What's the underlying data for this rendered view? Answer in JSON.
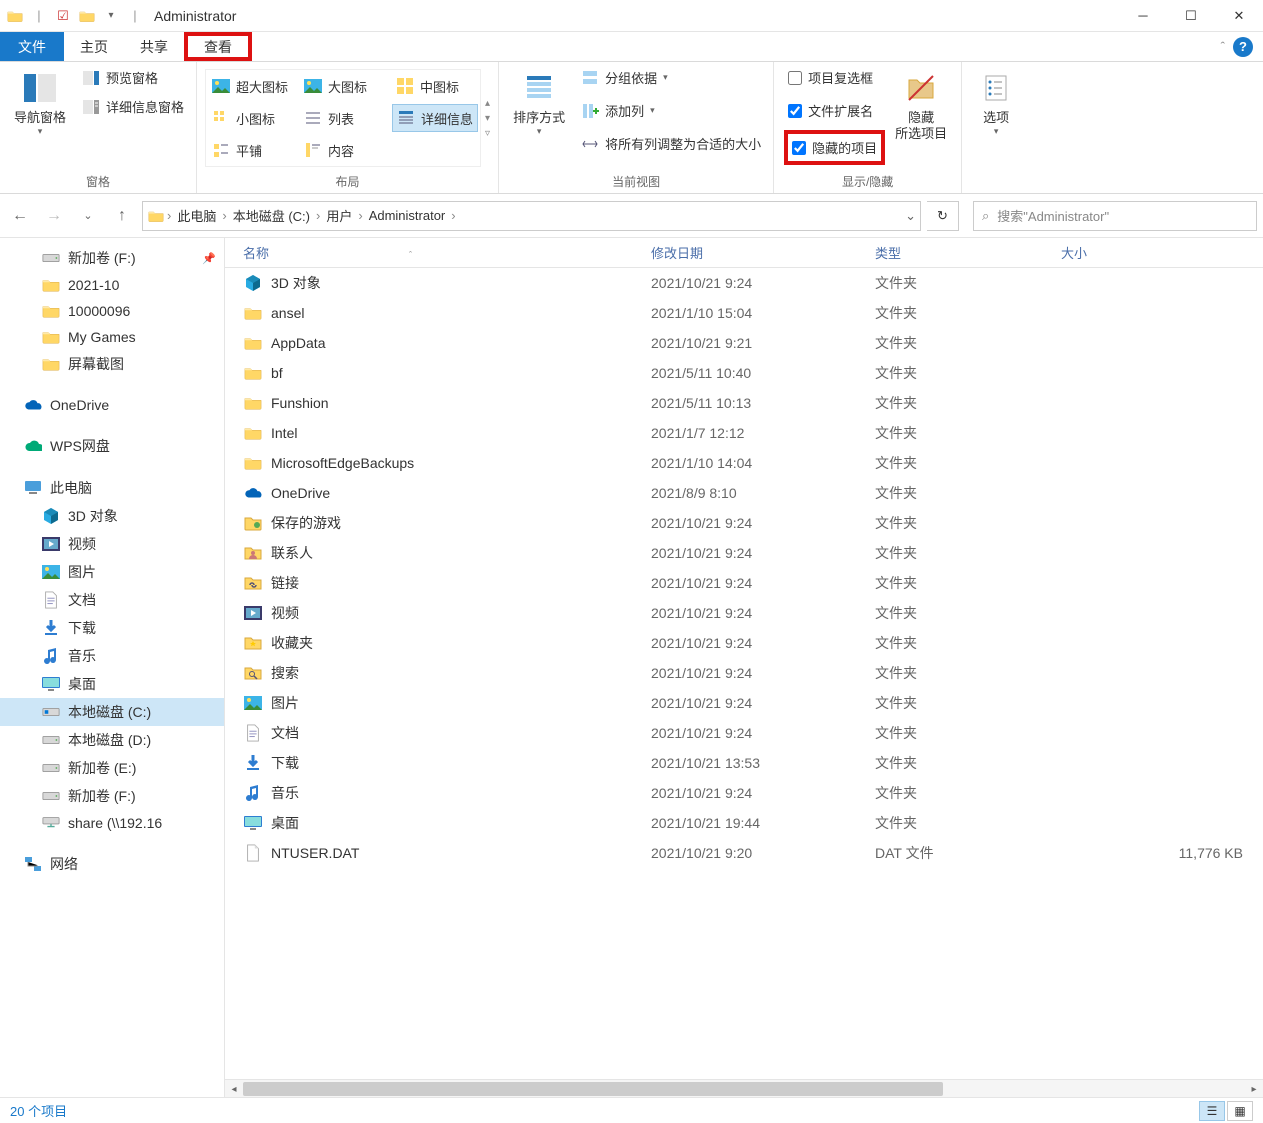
{
  "window": {
    "title": "Administrator"
  },
  "tabs": {
    "file": "文件",
    "home": "主页",
    "share": "共享",
    "view": "查看"
  },
  "ribbon": {
    "panes": {
      "label": "窗格",
      "nav": "导航窗格",
      "preview": "预览窗格",
      "details": "详细信息窗格"
    },
    "layout": {
      "label": "布局",
      "extraLarge": "超大图标",
      "large": "大图标",
      "medium": "中图标",
      "small": "小图标",
      "list": "列表",
      "details": "详细信息",
      "tiles": "平铺",
      "content": "内容"
    },
    "currentView": {
      "label": "当前视图",
      "sort": "排序方式",
      "group": "分组依据",
      "addCol": "添加列",
      "fitCols": "将所有列调整为合适的大小"
    },
    "showHide": {
      "label": "显示/隐藏",
      "checkboxes": "项目复选框",
      "extensions": "文件扩展名",
      "hidden": "隐藏的项目",
      "hideBtn": "隐藏\n所选项目"
    },
    "options": "选项"
  },
  "breadcrumb": {
    "segs": [
      "此电脑",
      "本地磁盘 (C:)",
      "用户",
      "Administrator"
    ]
  },
  "search": {
    "placeholder": "搜索\"Administrator\""
  },
  "sidebar": {
    "quick": [
      {
        "label": "新加卷 (F:)",
        "icon": "drive",
        "pin": true
      },
      {
        "label": "2021-10",
        "icon": "folder"
      },
      {
        "label": "10000096",
        "icon": "folder"
      },
      {
        "label": "My Games",
        "icon": "folder"
      },
      {
        "label": "屏幕截图",
        "icon": "folder"
      }
    ],
    "onedrive": "OneDrive",
    "wps": "WPS网盘",
    "thispc": "此电脑",
    "pcItems": [
      {
        "label": "3D 对象",
        "icon": "3d"
      },
      {
        "label": "视频",
        "icon": "video"
      },
      {
        "label": "图片",
        "icon": "pictures"
      },
      {
        "label": "文档",
        "icon": "doc"
      },
      {
        "label": "下载",
        "icon": "download"
      },
      {
        "label": "音乐",
        "icon": "music"
      },
      {
        "label": "桌面",
        "icon": "desktop"
      },
      {
        "label": "本地磁盘 (C:)",
        "icon": "osdrive",
        "selected": true
      },
      {
        "label": "本地磁盘 (D:)",
        "icon": "drive"
      },
      {
        "label": "新加卷 (E:)",
        "icon": "drive"
      },
      {
        "label": "新加卷 (F:)",
        "icon": "drive"
      },
      {
        "label": "share (\\\\192.16",
        "icon": "netdrive"
      }
    ],
    "network": "网络"
  },
  "columns": {
    "name": "名称",
    "date": "修改日期",
    "type": "类型",
    "size": "大小"
  },
  "files": [
    {
      "name": "3D 对象",
      "date": "2021/10/21 9:24",
      "type": "文件夹",
      "size": "",
      "icon": "3d"
    },
    {
      "name": "ansel",
      "date": "2021/1/10 15:04",
      "type": "文件夹",
      "size": "",
      "icon": "folder"
    },
    {
      "name": "AppData",
      "date": "2021/10/21 9:21",
      "type": "文件夹",
      "size": "",
      "icon": "folder"
    },
    {
      "name": "bf",
      "date": "2021/5/11 10:40",
      "type": "文件夹",
      "size": "",
      "icon": "folder"
    },
    {
      "name": "Funshion",
      "date": "2021/5/11 10:13",
      "type": "文件夹",
      "size": "",
      "icon": "folder"
    },
    {
      "name": "Intel",
      "date": "2021/1/7 12:12",
      "type": "文件夹",
      "size": "",
      "icon": "folder"
    },
    {
      "name": "MicrosoftEdgeBackups",
      "date": "2021/1/10 14:04",
      "type": "文件夹",
      "size": "",
      "icon": "folder"
    },
    {
      "name": "OneDrive",
      "date": "2021/8/9 8:10",
      "type": "文件夹",
      "size": "",
      "icon": "onedrive"
    },
    {
      "name": "保存的游戏",
      "date": "2021/10/21 9:24",
      "type": "文件夹",
      "size": "",
      "icon": "games"
    },
    {
      "name": "联系人",
      "date": "2021/10/21 9:24",
      "type": "文件夹",
      "size": "",
      "icon": "contacts"
    },
    {
      "name": "链接",
      "date": "2021/10/21 9:24",
      "type": "文件夹",
      "size": "",
      "icon": "links"
    },
    {
      "name": "视频",
      "date": "2021/10/21 9:24",
      "type": "文件夹",
      "size": "",
      "icon": "video"
    },
    {
      "name": "收藏夹",
      "date": "2021/10/21 9:24",
      "type": "文件夹",
      "size": "",
      "icon": "fav"
    },
    {
      "name": "搜索",
      "date": "2021/10/21 9:24",
      "type": "文件夹",
      "size": "",
      "icon": "search"
    },
    {
      "name": "图片",
      "date": "2021/10/21 9:24",
      "type": "文件夹",
      "size": "",
      "icon": "pictures"
    },
    {
      "name": "文档",
      "date": "2021/10/21 9:24",
      "type": "文件夹",
      "size": "",
      "icon": "doc"
    },
    {
      "name": "下载",
      "date": "2021/10/21 13:53",
      "type": "文件夹",
      "size": "",
      "icon": "download"
    },
    {
      "name": "音乐",
      "date": "2021/10/21 9:24",
      "type": "文件夹",
      "size": "",
      "icon": "music"
    },
    {
      "name": "桌面",
      "date": "2021/10/21 19:44",
      "type": "文件夹",
      "size": "",
      "icon": "desktop"
    },
    {
      "name": "NTUSER.DAT",
      "date": "2021/10/21 9:20",
      "type": "DAT 文件",
      "size": "11,776 KB",
      "icon": "file"
    }
  ],
  "status": {
    "count": "20 个项目"
  }
}
